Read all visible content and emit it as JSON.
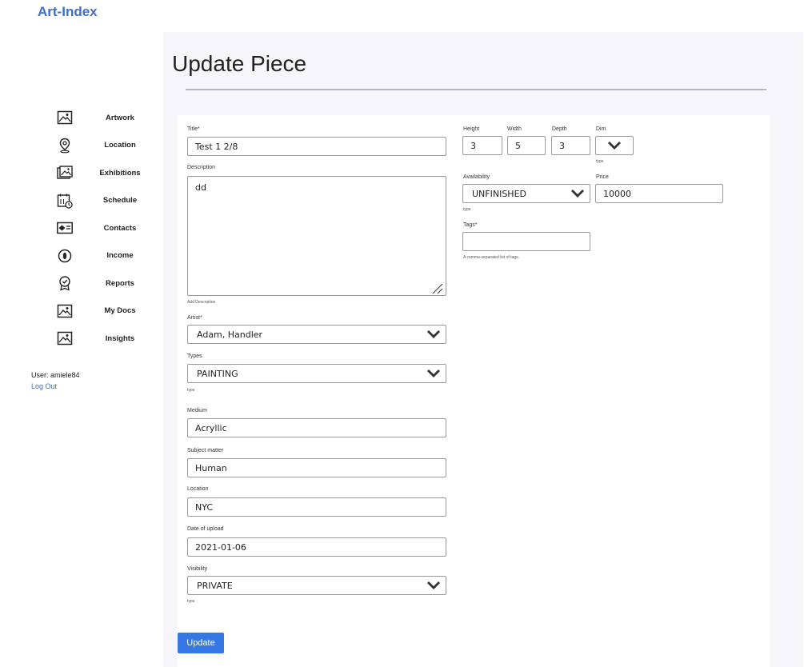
{
  "app": {
    "brand": "Art-Index"
  },
  "sidebar": {
    "items": [
      {
        "label": "Artwork",
        "icon": "picture-icon"
      },
      {
        "label": "Location",
        "icon": "location-pin-icon"
      },
      {
        "label": "Exhibitions",
        "icon": "gallery-icon"
      },
      {
        "label": "Schedule",
        "icon": "calendar-clock-icon"
      },
      {
        "label": "Contacts",
        "icon": "contact-card-icon"
      },
      {
        "label": "Income",
        "icon": "coin-icon"
      },
      {
        "label": "Reports",
        "icon": "award-badge-icon"
      },
      {
        "label": "My Docs",
        "icon": "picture-icon"
      },
      {
        "label": "Insights",
        "icon": "picture-icon"
      }
    ],
    "user": "User: amiele84",
    "logout": "Log Out"
  },
  "page": {
    "title": "Update Piece"
  },
  "form": {
    "title": {
      "label": "Title*",
      "value": "Test 1 2/8"
    },
    "description": {
      "label": "Description",
      "value": "dd",
      "hint": "Add Description"
    },
    "artist": {
      "label": "Artist*",
      "value": "Adam, Handler"
    },
    "types": {
      "label": "Types",
      "value": "PAINTING",
      "hint": "type"
    },
    "medium": {
      "label": "Medium",
      "value": "Acryllic"
    },
    "subject": {
      "label": "Subject matter",
      "value": "Human"
    },
    "location": {
      "label": "Location",
      "value": "NYC"
    },
    "date": {
      "label": "Date of upload",
      "value": "2021-01-06"
    },
    "visibility": {
      "label": "Visibility",
      "value": "PRIVATE",
      "hint": "type"
    },
    "height": {
      "label": "Height",
      "value": "3"
    },
    "width": {
      "label": "Width",
      "value": "5"
    },
    "depth": {
      "label": "Depth",
      "value": "3"
    },
    "dim": {
      "label": "Dim",
      "value": "",
      "hint": "type"
    },
    "availability": {
      "label": "Availability",
      "value": "UNFINISHED",
      "hint": "type"
    },
    "price": {
      "label": "Price",
      "value": "10000"
    },
    "tags": {
      "label": "Tags*",
      "value": "",
      "hint": "A comma-separated list of tags."
    },
    "submit": "Update"
  },
  "colors": {
    "accent": "#3578e5",
    "brand": "#3a6fd0",
    "panel_bg": "#f5f5fa"
  }
}
